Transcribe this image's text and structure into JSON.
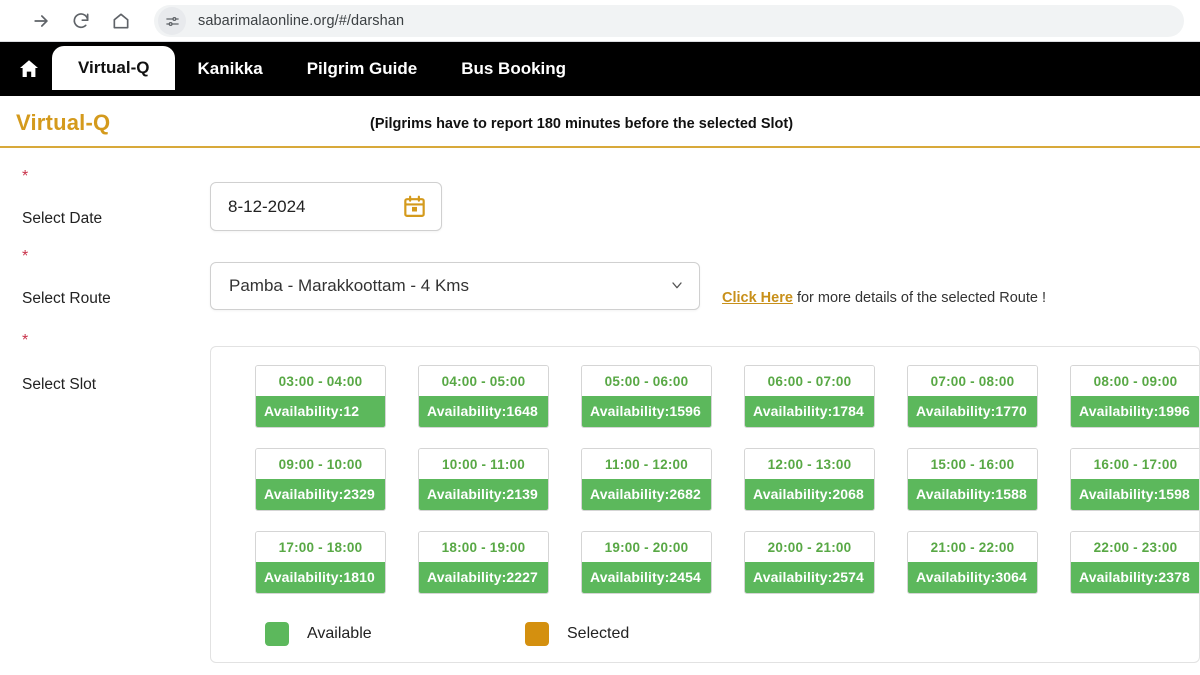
{
  "browser": {
    "url": "sabarimalaonline.org/#/darshan",
    "icons": {
      "forward": "forward-arrow-icon",
      "reload": "reload-icon",
      "home": "home-icon",
      "site_info": "page-settings-icon"
    }
  },
  "site_nav": {
    "home_icon": "home-icon",
    "tabs": [
      {
        "label": "Virtual-Q",
        "active": true
      },
      {
        "label": "Kanikka",
        "active": false
      },
      {
        "label": "Pilgrim Guide",
        "active": false
      },
      {
        "label": "Bus Booking",
        "active": false
      }
    ]
  },
  "page": {
    "title": "Virtual-Q",
    "note": "(Pilgrims have to report 180 minutes before the selected Slot)",
    "accent_color": "#d49a1c",
    "divider_color": "#d8a93a"
  },
  "form": {
    "date": {
      "label": "Select Date",
      "required_mark": "*",
      "value": "8-12-2024",
      "icon": "calendar-icon"
    },
    "route": {
      "label": "Select Route",
      "required_mark": "*",
      "value": "Pamba - Marakkoottam - 4 Kms",
      "chevron": "chevron-down-icon",
      "hint_link": "Click Here",
      "hint_text": " for more details of the selected Route !"
    },
    "slot": {
      "label": "Select Slot",
      "required_mark": "*"
    }
  },
  "slots": [
    {
      "time": "03:00 - 04:00",
      "availability": "Availability:12",
      "state": "available"
    },
    {
      "time": "04:00 - 05:00",
      "availability": "Availability:1648",
      "state": "available"
    },
    {
      "time": "05:00 - 06:00",
      "availability": "Availability:1596",
      "state": "available"
    },
    {
      "time": "06:00 - 07:00",
      "availability": "Availability:1784",
      "state": "available"
    },
    {
      "time": "07:00 - 08:00",
      "availability": "Availability:1770",
      "state": "available"
    },
    {
      "time": "08:00 - 09:00",
      "availability": "Availability:1996",
      "state": "available"
    },
    {
      "time": "09:00 - 10:00",
      "availability": "Availability:2329",
      "state": "available"
    },
    {
      "time": "10:00 - 11:00",
      "availability": "Availability:2139",
      "state": "available"
    },
    {
      "time": "11:00 - 12:00",
      "availability": "Availability:2682",
      "state": "available"
    },
    {
      "time": "12:00 - 13:00",
      "availability": "Availability:2068",
      "state": "available"
    },
    {
      "time": "15:00 - 16:00",
      "availability": "Availability:1588",
      "state": "available"
    },
    {
      "time": "16:00 - 17:00",
      "availability": "Availability:1598",
      "state": "available"
    },
    {
      "time": "17:00 - 18:00",
      "availability": "Availability:1810",
      "state": "available"
    },
    {
      "time": "18:00 - 19:00",
      "availability": "Availability:2227",
      "state": "available"
    },
    {
      "time": "19:00 - 20:00",
      "availability": "Availability:2454",
      "state": "available"
    },
    {
      "time": "20:00 - 21:00",
      "availability": "Availability:2574",
      "state": "available"
    },
    {
      "time": "21:00 - 22:00",
      "availability": "Availability:3064",
      "state": "available"
    },
    {
      "time": "22:00 - 23:00",
      "availability": "Availability:2378",
      "state": "available"
    }
  ],
  "legend": [
    {
      "label": "Available",
      "color": "#5cb85c"
    },
    {
      "label": "Selected",
      "color": "#d4900f"
    }
  ]
}
